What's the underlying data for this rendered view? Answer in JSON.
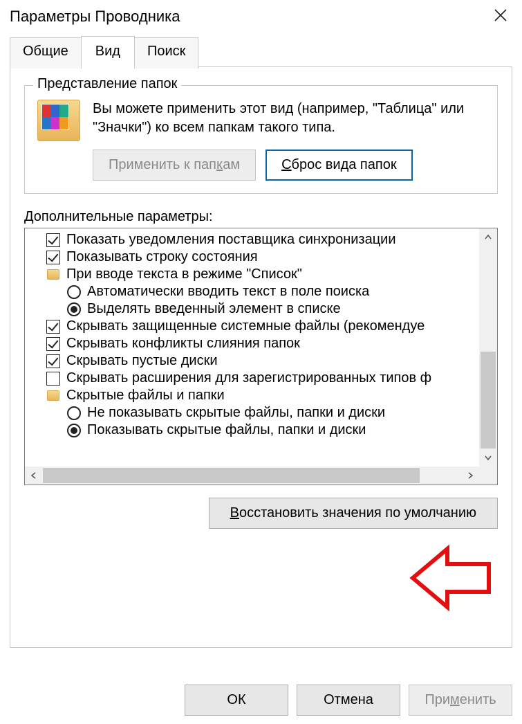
{
  "title": "Параметры Проводника",
  "tabs": {
    "general": "Общие",
    "view": "Вид",
    "search": "Поиск"
  },
  "group": {
    "title": "Представление папок",
    "desc": "Вы можете применить этот вид (например, \"Таблица\" или \"Значки\") ко всем папкам такого типа.",
    "apply_prefix": "Применить к пап",
    "apply_underline": "к",
    "apply_suffix": "ам",
    "reset_underline": "С",
    "reset_suffix": "брос вида папок"
  },
  "adv": {
    "label": "Дополнительные параметры:",
    "items": [
      {
        "kind": "check",
        "checked": true,
        "label": "Показать уведомления поставщика синхронизации"
      },
      {
        "kind": "check",
        "checked": true,
        "label": "Показывать строку состояния"
      },
      {
        "kind": "group",
        "label": "При вводе текста в режиме \"Список\""
      },
      {
        "kind": "radio",
        "selected": false,
        "label": "Автоматически вводить текст в поле поиска"
      },
      {
        "kind": "radio",
        "selected": true,
        "label": "Выделять введенный элемент в списке"
      },
      {
        "kind": "check",
        "checked": true,
        "label": "Скрывать защищенные системные файлы (рекомендуе"
      },
      {
        "kind": "check",
        "checked": true,
        "label": "Скрывать конфликты слияния папок"
      },
      {
        "kind": "check",
        "checked": true,
        "label": "Скрывать пустые диски"
      },
      {
        "kind": "check",
        "checked": false,
        "label": "Скрывать расширения для зарегистрированных типов ф"
      },
      {
        "kind": "group",
        "label": "Скрытые файлы и папки"
      },
      {
        "kind": "radio",
        "selected": false,
        "label": "Не показывать скрытые файлы, папки и диски"
      },
      {
        "kind": "radio",
        "selected": true,
        "label": "Показывать скрытые файлы, папки и диски"
      }
    ]
  },
  "restore_underline": "В",
  "restore_suffix": "осстановить значения по умолчанию",
  "buttons": {
    "ok": "ОК",
    "cancel": "Отмена",
    "apply_prefix": "При",
    "apply_underline": "м",
    "apply_suffix": "енить"
  }
}
